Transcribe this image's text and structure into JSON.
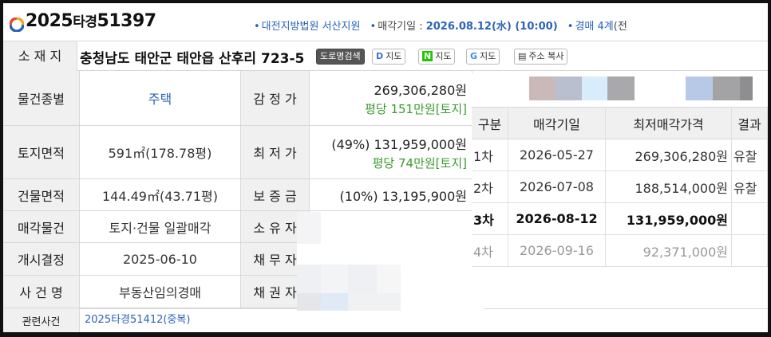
{
  "header": {
    "case_year": "2025",
    "case_type": "타경",
    "case_num": "51397",
    "court": "대전지방법원 서산지원",
    "sale_date_label": "매각기일 : ",
    "sale_date": "2026.08.12(水) (10:00)",
    "dept": "경매 4계",
    "dept_suffix": "(전"
  },
  "address": {
    "label": "소 재 지",
    "text": "충청남도 태안군 태안읍 산후리 723-5",
    "buttons": [
      "도로명검색",
      "지도",
      "지도",
      "지도",
      "주소 복사"
    ],
    "button_icons": [
      "",
      "D",
      "N",
      "G",
      "doc-icon"
    ]
  },
  "rows": [
    {
      "label": "물건종별",
      "value": "주택",
      "label2": "감 정 가",
      "price": "269,306,280원",
      "sub": "평당 151만원[토지]"
    },
    {
      "label": "토지면적",
      "value": "591㎡(178.78평)",
      "label2": "최 저 가",
      "price": "(49%) 131,959,000원",
      "sub": "평당 74만원[토지]"
    },
    {
      "label": "건물면적",
      "value": "144.49㎡(43.71평)",
      "label2": "보 증 금",
      "price": "(10%) 13,195,900원",
      "sub": ""
    },
    {
      "label": "매각물건",
      "value": "토지·건물 일괄매각",
      "label2": "소 유 자",
      "price": "",
      "sub": ""
    },
    {
      "label": "개시결정",
      "value": "2025-06-10",
      "label2": "채 무 자",
      "price": "",
      "sub": ""
    },
    {
      "label": "사 건 명",
      "value": "부동산임의경매",
      "label2": "채 권 자",
      "price": "",
      "sub": ""
    }
  ],
  "related": {
    "label": "관련사건",
    "value": "2025타경51412(중복)"
  },
  "history": {
    "headers": [
      "구분",
      "매각기일",
      "최저매각가격",
      "결과"
    ],
    "rows": [
      {
        "round": "1차",
        "date": "2026-05-27",
        "price": "269,306,280원",
        "result": "유찰"
      },
      {
        "round": "2차",
        "date": "2026-07-08",
        "price": "188,514,000원",
        "result": "유찰"
      },
      {
        "round": "3차",
        "date": "2026-08-12",
        "price": "131,959,000원",
        "result": ""
      },
      {
        "round": "4차",
        "date": "2026-09-16",
        "price": "92,371,000원",
        "result": ""
      }
    ]
  },
  "colors": {
    "accent": "#2a63b8",
    "green": "#3a9a2f",
    "label_bg": "#f0f0f0"
  }
}
